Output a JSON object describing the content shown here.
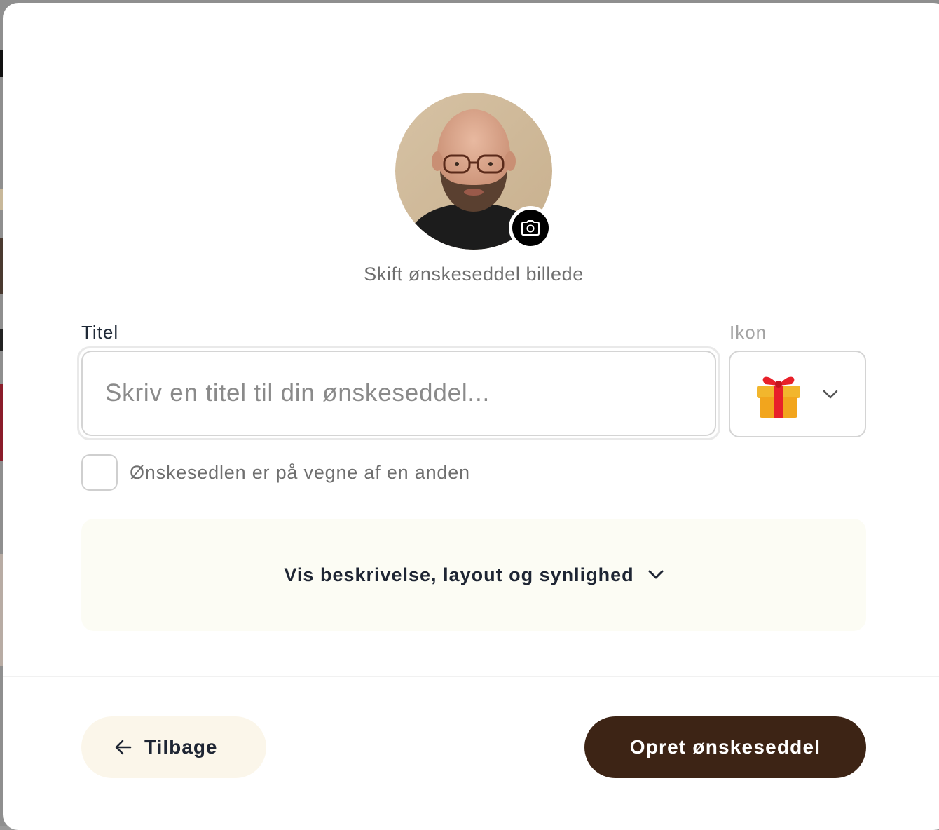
{
  "avatar": {
    "alt": "profile photo",
    "change_photo_label": "Skift ønskeseddel billede"
  },
  "form": {
    "title_label": "Titel",
    "title_placeholder": "Skriv en titel til din ønskeseddel...",
    "title_value": "",
    "icon_label": "Ikon",
    "icon_selected": "🎁",
    "on_behalf_label": "Ønskesedlen er på vegne af en anden",
    "on_behalf_checked": false
  },
  "disclosure": {
    "label": "Vis beskrivelse, layout og synlighed"
  },
  "footer": {
    "back_label": "Tilbage",
    "create_label": "Opret ønskeseddel"
  },
  "colors": {
    "primary_button": "#3d2415",
    "back_button": "#fbf6ea",
    "disclosure_bg": "#fcfcf4",
    "text_dark": "#1e2533",
    "text_muted": "#6f6f6f"
  },
  "icons": [
    "camera-icon",
    "gift-icon",
    "chevron-down-icon",
    "arrow-left-icon"
  ]
}
